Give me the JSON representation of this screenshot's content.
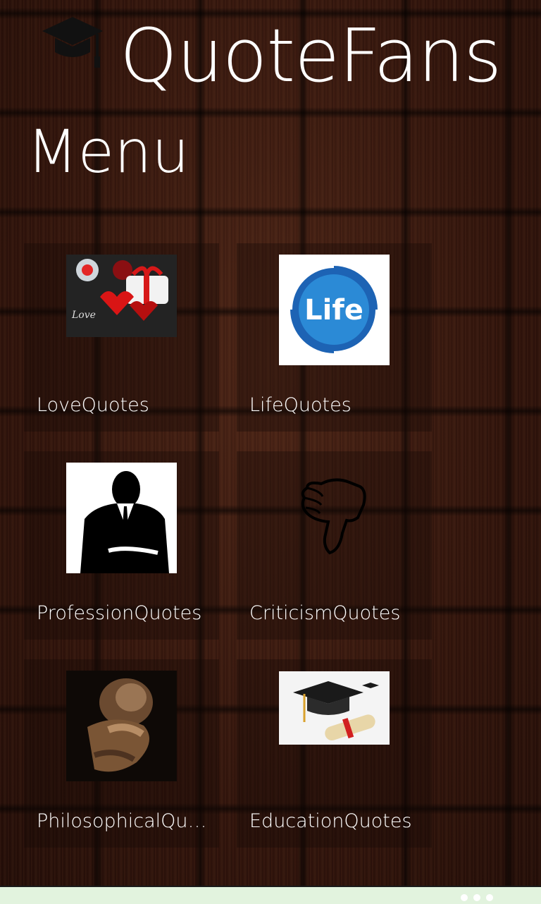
{
  "header": {
    "title": "QuoteFans",
    "logo_icon": "graduation-cap-icon"
  },
  "page": {
    "title": "Menu"
  },
  "tiles": [
    {
      "label": "LoveQuotes",
      "icon": "love-gift-image"
    },
    {
      "label": "LifeQuotes",
      "icon": "life-logo-image"
    },
    {
      "label": "ProfessionQuotes",
      "icon": "businessman-silhouette-image"
    },
    {
      "label": "CriticismQuotes",
      "icon": "thumbs-down-icon"
    },
    {
      "label": "PhilosophicalQuot..",
      "icon": "thinker-statue-image"
    },
    {
      "label": "EducationQuotes",
      "icon": "graduation-cap-diploma-image"
    }
  ],
  "bottom_bar": {
    "icon": "more-dots-icon"
  },
  "colors": {
    "accent_life_blue": "#1d63b4",
    "bottom_bar": "#e2f3de"
  }
}
